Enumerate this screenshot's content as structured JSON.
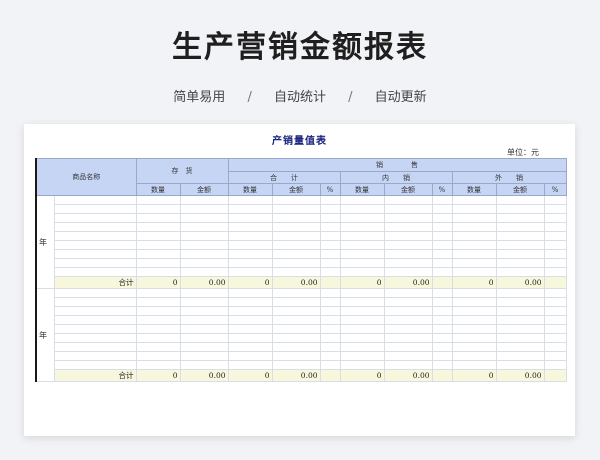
{
  "header": {
    "title": "生产营销金额报表",
    "tags": [
      "简单易用",
      "自动统计",
      "自动更新"
    ],
    "separator": "/"
  },
  "sheet": {
    "title": "产销量值表",
    "unit": "单位：元",
    "columns": {
      "name": "商品名称",
      "inventory": "存　货",
      "sales": "销　　　　售",
      "total": "合　　计",
      "domestic": "内　　销",
      "export": "外　　销",
      "qty": "数量",
      "amount": "金额",
      "pct": "%"
    },
    "sections": [
      {
        "year_label": "年",
        "total_row": {
          "label": "合计",
          "inv_qty": "0",
          "inv_amt": "0.00",
          "tot_qty": "0",
          "tot_amt": "0.00",
          "dom_qty": "0",
          "dom_amt": "0.00",
          "exp_qty": "0",
          "exp_amt": "0.00"
        }
      },
      {
        "year_label": "年",
        "total_row": {
          "label": "合计",
          "inv_qty": "0",
          "inv_amt": "0.00",
          "tot_qty": "0",
          "tot_amt": "0.00",
          "dom_qty": "0",
          "dom_amt": "0.00",
          "exp_qty": "0",
          "exp_amt": "0.00"
        }
      }
    ]
  },
  "colors": {
    "header_bg": "#c7d5f5",
    "total_bg": "#f6f7dc",
    "title_color": "#1a237e"
  }
}
